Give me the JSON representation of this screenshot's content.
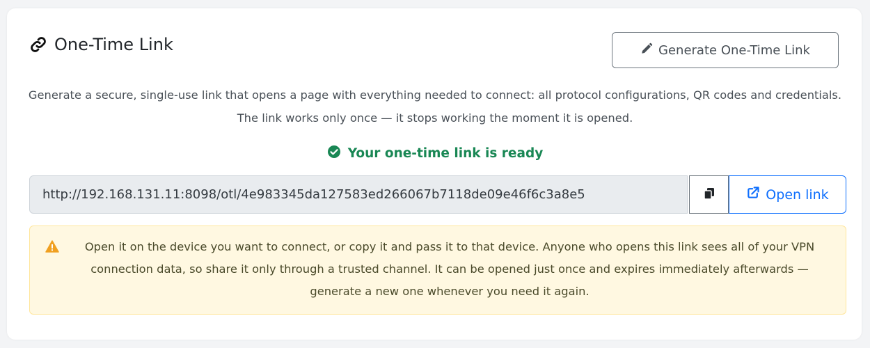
{
  "section": {
    "title": "One-Time Link",
    "title_icon": "link-icon",
    "generate_button_label": "Generate One-Time Link",
    "generate_button_icon": "pencil-icon",
    "description": "Generate a secure, single-use link that opens a page with everything needed to connect: all protocol configurations, QR codes and credentials. The link works only once — it stops working the moment it is opened."
  },
  "status": {
    "icon": "check-circle-icon",
    "text": "Your one-time link is ready",
    "color": "#198754"
  },
  "link": {
    "url": "http://192.168.131.11:8098/otl/4e983345da127583ed266067b7118de09e46f6c3a8e5",
    "copy_icon": "copy-icon",
    "open_label": "Open link",
    "open_icon": "external-link-icon",
    "accent": "#0d6efd"
  },
  "warning": {
    "icon": "warning-triangle-icon",
    "text": "Open it on the device you want to connect, or copy it and pass it to that device. Anyone who opens this link sees all of your VPN connection data, so share it only through a trusted channel. It can be opened just once and expires immediately afterwards — generate a new one whenever you need it again.",
    "background": "#fff8e1",
    "icon_color": "#f0a020"
  }
}
